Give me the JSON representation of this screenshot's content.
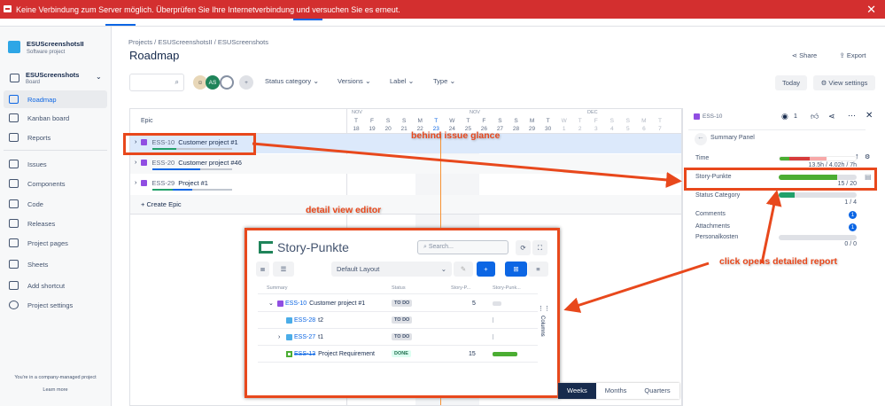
{
  "banner": {
    "message": "Keine Verbindung zum Server möglich. Überprüfen Sie Ihre Internetverbindung und versuchen Sie es erneut."
  },
  "sidebar": {
    "project_name": "ESUScreenshotsII",
    "project_type": "Software project",
    "board_name": "ESUScreenshots",
    "board_type": "Board",
    "items": [
      {
        "label": "Roadmap"
      },
      {
        "label": "Kanban board"
      },
      {
        "label": "Reports"
      },
      {
        "label": "Issues"
      },
      {
        "label": "Components"
      },
      {
        "label": "Code"
      },
      {
        "label": "Releases"
      },
      {
        "label": "Project pages"
      },
      {
        "label": "Sheets"
      },
      {
        "label": "Add shortcut"
      },
      {
        "label": "Project settings"
      }
    ],
    "footer": "You're in a company-managed project",
    "learn_more": "Learn more"
  },
  "header": {
    "breadcrumb": [
      "Projects",
      "ESUScreenshotsII",
      "ESUScreenshots"
    ],
    "title": "Roadmap",
    "share": "Share",
    "export": "Export"
  },
  "toolbar": {
    "avatar_initials": "AS",
    "filters": [
      "Status category",
      "Versions",
      "Label",
      "Type"
    ],
    "today": "Today",
    "view_settings": "View settings"
  },
  "timeline": {
    "epic_header": "Epic",
    "months": [
      "NOV",
      "NOV",
      "DEC"
    ],
    "days": [
      {
        "w": "T",
        "d": "18"
      },
      {
        "w": "F",
        "d": "19"
      },
      {
        "w": "S",
        "d": "20"
      },
      {
        "w": "S",
        "d": "21"
      },
      {
        "w": "M",
        "d": "22"
      },
      {
        "w": "T",
        "d": "23"
      },
      {
        "w": "W",
        "d": "24"
      },
      {
        "w": "T",
        "d": "25"
      },
      {
        "w": "F",
        "d": "26"
      },
      {
        "w": "S",
        "d": "27"
      },
      {
        "w": "S",
        "d": "28"
      },
      {
        "w": "M",
        "d": "29"
      },
      {
        "w": "T",
        "d": "30"
      },
      {
        "w": "W",
        "d": "1"
      },
      {
        "w": "T",
        "d": "2"
      },
      {
        "w": "F",
        "d": "3"
      },
      {
        "w": "S",
        "d": "4"
      },
      {
        "w": "S",
        "d": "5"
      },
      {
        "w": "M",
        "d": "6"
      },
      {
        "w": "T",
        "d": "7"
      }
    ],
    "epics": [
      {
        "key": "ESS-10",
        "title": "Customer project #1"
      },
      {
        "key": "ESS-20",
        "title": "Customer project #46"
      },
      {
        "key": "ESS-29",
        "title": "Project #1"
      }
    ],
    "create_epic": "Create Epic",
    "zoom": [
      "Weeks",
      "Months",
      "Quarters"
    ]
  },
  "panel": {
    "key": "ESS-10",
    "watchers": "1",
    "title": "Summary Panel",
    "fields": [
      {
        "label": "Time",
        "value": "13.5h / 4.02h / 7h"
      },
      {
        "label": "Story-Punkte",
        "value": "15 / 20",
        "progress": 0.75
      },
      {
        "label": "Status Category",
        "value": "1 / 4",
        "progress": 0.25
      },
      {
        "label": "Comments",
        "badge": "1"
      },
      {
        "label": "Attachments",
        "badge": "1"
      },
      {
        "label": "Personalkosten",
        "value": "0 / 0",
        "progress": 0
      }
    ]
  },
  "detail": {
    "title": "Story-Punkte",
    "search_placeholder": "Search...",
    "layout": "Default Layout",
    "columns_label": "Columns",
    "headers": [
      "Summary",
      "Status",
      "Story-P...",
      "Story-Punk..."
    ],
    "rows": [
      {
        "key": "ESS-10",
        "title": "Customer project #1",
        "status": "TO DO",
        "points": "5"
      },
      {
        "key": "ESS-28",
        "title": "t2",
        "status": "TO DO",
        "points": ""
      },
      {
        "key": "ESS-27",
        "title": "t1",
        "status": "TO DO",
        "points": ""
      },
      {
        "key": "ESS-13",
        "title": "Project Requirement",
        "status": "DONE",
        "points": "15"
      }
    ]
  },
  "annotations": {
    "glance": "behind issue glance",
    "editor": "detail view editor",
    "report": "click opens detailed report"
  }
}
